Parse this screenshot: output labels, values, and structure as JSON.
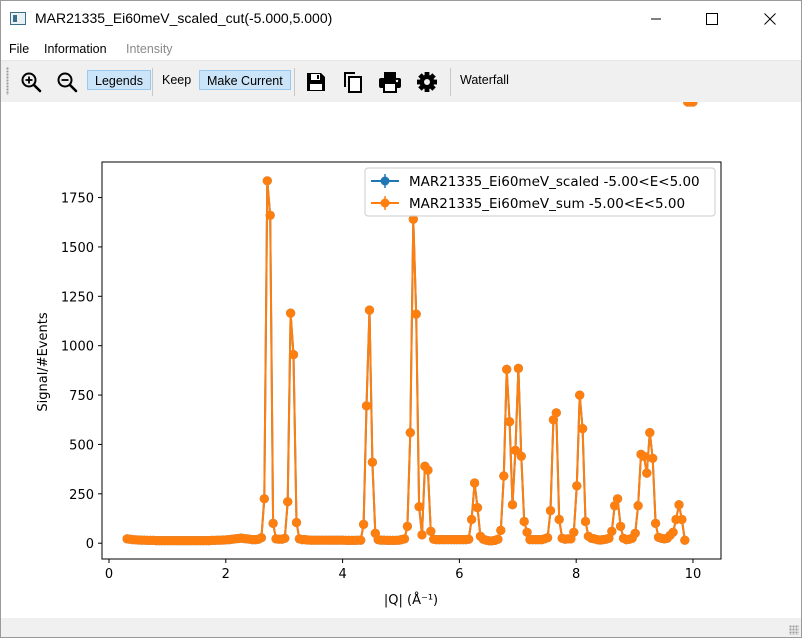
{
  "window": {
    "title": "MAR21335_Ei60meV_scaled_cut(-5.000,5.000)"
  },
  "menu": {
    "file": "File",
    "information": "Information",
    "intensity": "Intensity"
  },
  "toolbar": {
    "legends": "Legends",
    "keep": "Keep",
    "make_current": "Make Current",
    "waterfall": "Waterfall"
  },
  "colors": {
    "series_scaled": "#1f77b4",
    "series_sum": "#ff7f0e"
  },
  "chart_data": {
    "type": "line",
    "xlabel": "|Q| (Å⁻¹)",
    "ylabel": "Signal/#Events",
    "xlim": [
      -0.12,
      10.48
    ],
    "ylim": [
      -80,
      1930
    ],
    "xticks": [
      0,
      2,
      4,
      6,
      8,
      10
    ],
    "yticks": [
      0,
      250,
      500,
      750,
      1000,
      1250,
      1500,
      1750
    ],
    "grid": false,
    "legend_position": "top-right",
    "series": [
      {
        "name": "MAR21335_Ei60meV_scaled -5.00<E<5.00",
        "color": "#1f77b4",
        "marker": "o",
        "error_bars": true
      },
      {
        "name": "MAR21335_Ei60meV_sum -5.00<E<5.00",
        "color": "#ff7f0e",
        "marker": "o",
        "error_bars": true
      }
    ],
    "x": [
      0.31,
      0.36,
      0.41,
      0.46,
      0.51,
      0.56,
      0.61,
      0.66,
      0.71,
      0.76,
      0.81,
      0.86,
      0.91,
      0.96,
      1.01,
      1.06,
      1.11,
      1.16,
      1.21,
      1.26,
      1.31,
      1.36,
      1.41,
      1.46,
      1.51,
      1.56,
      1.61,
      1.66,
      1.71,
      1.76,
      1.81,
      1.86,
      1.91,
      1.96,
      2.01,
      2.06,
      2.11,
      2.16,
      2.21,
      2.26,
      2.31,
      2.36,
      2.41,
      2.46,
      2.51,
      2.56,
      2.61,
      2.66,
      2.71,
      2.76,
      2.81,
      2.86,
      2.91,
      2.96,
      3.01,
      3.06,
      3.11,
      3.16,
      3.21,
      3.26,
      3.31,
      3.36,
      3.41,
      3.46,
      3.51,
      3.56,
      3.61,
      3.66,
      3.71,
      3.76,
      3.81,
      3.86,
      3.91,
      3.96,
      4.01,
      4.06,
      4.11,
      4.16,
      4.21,
      4.26,
      4.31,
      4.36,
      4.41,
      4.46,
      4.51,
      4.56,
      4.61,
      4.66,
      4.71,
      4.76,
      4.81,
      4.86,
      4.91,
      4.96,
      5.01,
      5.06,
      5.11,
      5.16,
      5.21,
      5.26,
      5.31,
      5.36,
      5.41,
      5.46,
      5.51,
      5.56,
      5.61,
      5.66,
      5.71,
      5.76,
      5.81,
      5.86,
      5.91,
      5.96,
      6.01,
      6.06,
      6.11,
      6.16,
      6.21,
      6.26,
      6.31,
      6.36,
      6.41,
      6.46,
      6.51,
      6.56,
      6.61,
      6.66,
      6.71,
      6.76,
      6.81,
      6.86,
      6.91,
      6.96,
      7.01,
      7.06,
      7.11,
      7.16,
      7.21,
      7.26,
      7.31,
      7.36,
      7.41,
      7.46,
      7.51,
      7.56,
      7.61,
      7.66,
      7.71,
      7.76,
      7.81,
      7.86,
      7.91,
      7.96,
      8.01,
      8.06,
      8.11,
      8.16,
      8.21,
      8.26,
      8.31,
      8.36,
      8.41,
      8.46,
      8.51,
      8.56,
      8.61,
      8.66,
      8.71,
      8.76,
      8.81,
      8.86,
      8.91,
      8.96,
      9.01,
      9.06,
      9.11,
      9.16,
      9.21,
      9.26,
      9.31,
      9.36,
      9.41,
      9.46,
      9.51,
      9.56,
      9.61,
      9.66,
      9.71,
      9.76,
      9.81,
      9.86,
      9.91,
      9.96,
      10.0
    ],
    "y": [
      22,
      20,
      18,
      17,
      16,
      15,
      15,
      14,
      14,
      14,
      13,
      13,
      13,
      13,
      13,
      13,
      13,
      13,
      13,
      13,
      13,
      13,
      13,
      13,
      13,
      13,
      13,
      13,
      13,
      14,
      14,
      15,
      15,
      16,
      17,
      18,
      20,
      22,
      24,
      26,
      24,
      22,
      20,
      18,
      18,
      20,
      28,
      225,
      1835,
      1660,
      100,
      22,
      20,
      20,
      25,
      210,
      1165,
      955,
      105,
      22,
      18,
      18,
      16,
      15,
      15,
      15,
      15,
      15,
      15,
      15,
      15,
      15,
      15,
      15,
      15,
      14,
      14,
      14,
      14,
      15,
      15,
      95,
      695,
      1180,
      410,
      50,
      18,
      15,
      15,
      14,
      14,
      14,
      14,
      15,
      18,
      22,
      85,
      560,
      1640,
      1160,
      185,
      42,
      390,
      370,
      60,
      20,
      18,
      18,
      18,
      18,
      18,
      18,
      18,
      18,
      18,
      18,
      18,
      20,
      120,
      305,
      180,
      35,
      20,
      15,
      12,
      12,
      14,
      20,
      65,
      340,
      880,
      615,
      195,
      470,
      885,
      440,
      110,
      55,
      18,
      18,
      18,
      18,
      18,
      22,
      28,
      165,
      625,
      660,
      120,
      25,
      20,
      22,
      22,
      55,
      290,
      750,
      580,
      110,
      35,
      25,
      22,
      18,
      16,
      18,
      20,
      25,
      60,
      190,
      225,
      85,
      25,
      18,
      20,
      25,
      50,
      190,
      450,
      440,
      355,
      560,
      430,
      100,
      30,
      25,
      22,
      25,
      40,
      55,
      120,
      195,
      120,
      15
    ]
  }
}
